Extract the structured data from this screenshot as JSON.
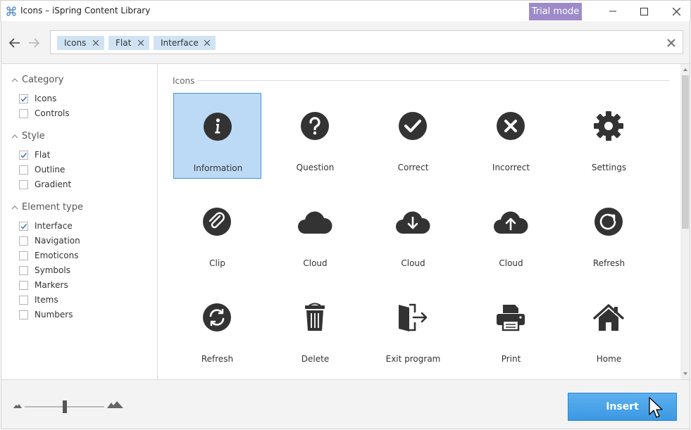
{
  "window": {
    "title": "Icons – iSpring Content Library",
    "trial_badge": "Trial mode"
  },
  "search": {
    "chips": [
      "Icons",
      "Flat",
      "Interface"
    ]
  },
  "sidebar": {
    "groups": [
      {
        "label": "Category",
        "options": [
          {
            "label": "Icons",
            "checked": true
          },
          {
            "label": "Controls",
            "checked": false
          }
        ]
      },
      {
        "label": "Style",
        "options": [
          {
            "label": "Flat",
            "checked": true
          },
          {
            "label": "Outline",
            "checked": false
          },
          {
            "label": "Gradient",
            "checked": false
          }
        ]
      },
      {
        "label": "Element type",
        "options": [
          {
            "label": "Interface",
            "checked": true
          },
          {
            "label": "Navigation",
            "checked": false
          },
          {
            "label": "Emoticons",
            "checked": false
          },
          {
            "label": "Symbols",
            "checked": false
          },
          {
            "label": "Markers",
            "checked": false
          },
          {
            "label": "Items",
            "checked": false
          },
          {
            "label": "Numbers",
            "checked": false
          }
        ]
      }
    ]
  },
  "main": {
    "section_title": "Icons",
    "selected_index": 0,
    "items": [
      {
        "label": "Information",
        "icon": "information-icon"
      },
      {
        "label": "Question",
        "icon": "question-icon"
      },
      {
        "label": "Correct",
        "icon": "correct-icon"
      },
      {
        "label": "Incorrect",
        "icon": "incorrect-icon"
      },
      {
        "label": "Settings",
        "icon": "settings-icon"
      },
      {
        "label": "Clip",
        "icon": "clip-icon"
      },
      {
        "label": "Cloud",
        "icon": "cloud-icon"
      },
      {
        "label": "Cloud",
        "icon": "cloud-download-icon"
      },
      {
        "label": "Cloud",
        "icon": "cloud-upload-icon"
      },
      {
        "label": "Refresh",
        "icon": "refresh-icon"
      },
      {
        "label": "Refresh",
        "icon": "refresh-cycle-icon"
      },
      {
        "label": "Delete",
        "icon": "delete-icon"
      },
      {
        "label": "Exit program",
        "icon": "exit-program-icon"
      },
      {
        "label": "Print",
        "icon": "print-icon"
      },
      {
        "label": "Home",
        "icon": "home-icon"
      }
    ]
  },
  "footer": {
    "insert_label": "Insert"
  },
  "colors": {
    "accent": "#3c98e3",
    "selection": "#bcdaf6",
    "trial": "#9d8bc9",
    "icon": "#333333"
  }
}
